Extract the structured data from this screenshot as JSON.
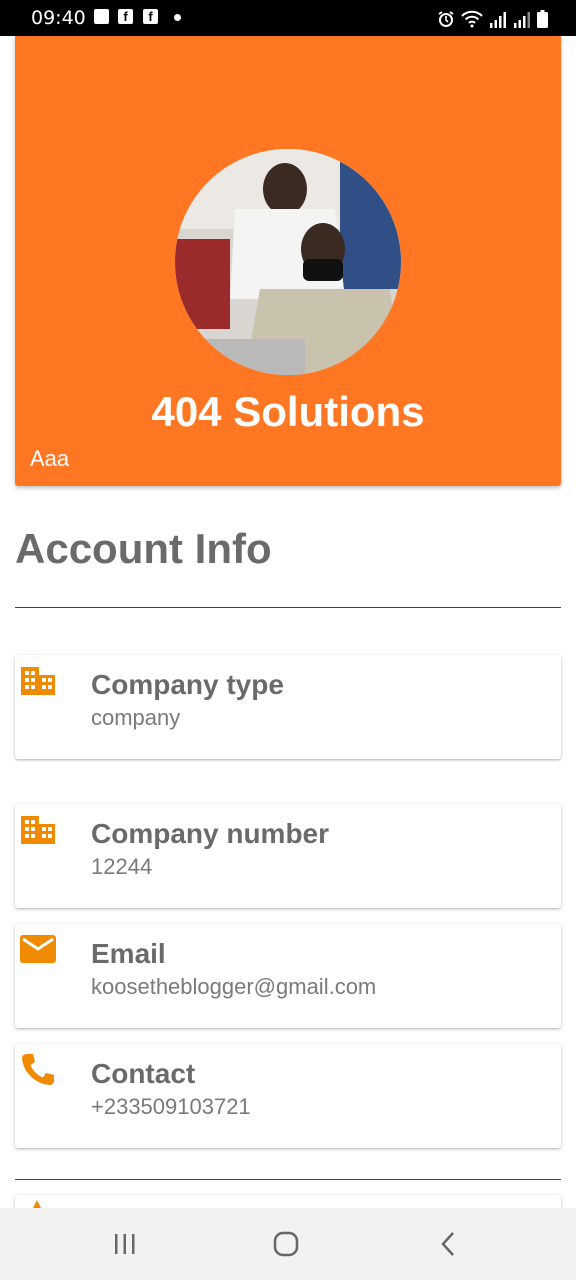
{
  "status_bar": {
    "time": "09:40",
    "icons": [
      "image-icon",
      "facebook-icon",
      "facebook-icon",
      "dot-icon",
      "alarm-icon",
      "wifi-icon",
      "signal-icon",
      "signal-icon",
      "battery-icon"
    ],
    "fb_glyph": "f"
  },
  "header": {
    "company_name": "404 Solutions",
    "subtitle": "Aaa",
    "accent_color": "#ff7722"
  },
  "section": {
    "title": "Account Info"
  },
  "info_items": [
    {
      "icon": "building-icon",
      "label": "Company type",
      "value": "company"
    },
    {
      "icon": "building-icon",
      "label": "Company number",
      "value": "12244"
    },
    {
      "icon": "email-icon",
      "label": "Email",
      "value": "koosetheblogger@gmail.com"
    },
    {
      "icon": "phone-icon",
      "label": "Contact",
      "value": "+233509103721"
    }
  ],
  "nav_bar": {
    "buttons": [
      "recent-apps-icon",
      "home-icon",
      "back-icon"
    ]
  }
}
